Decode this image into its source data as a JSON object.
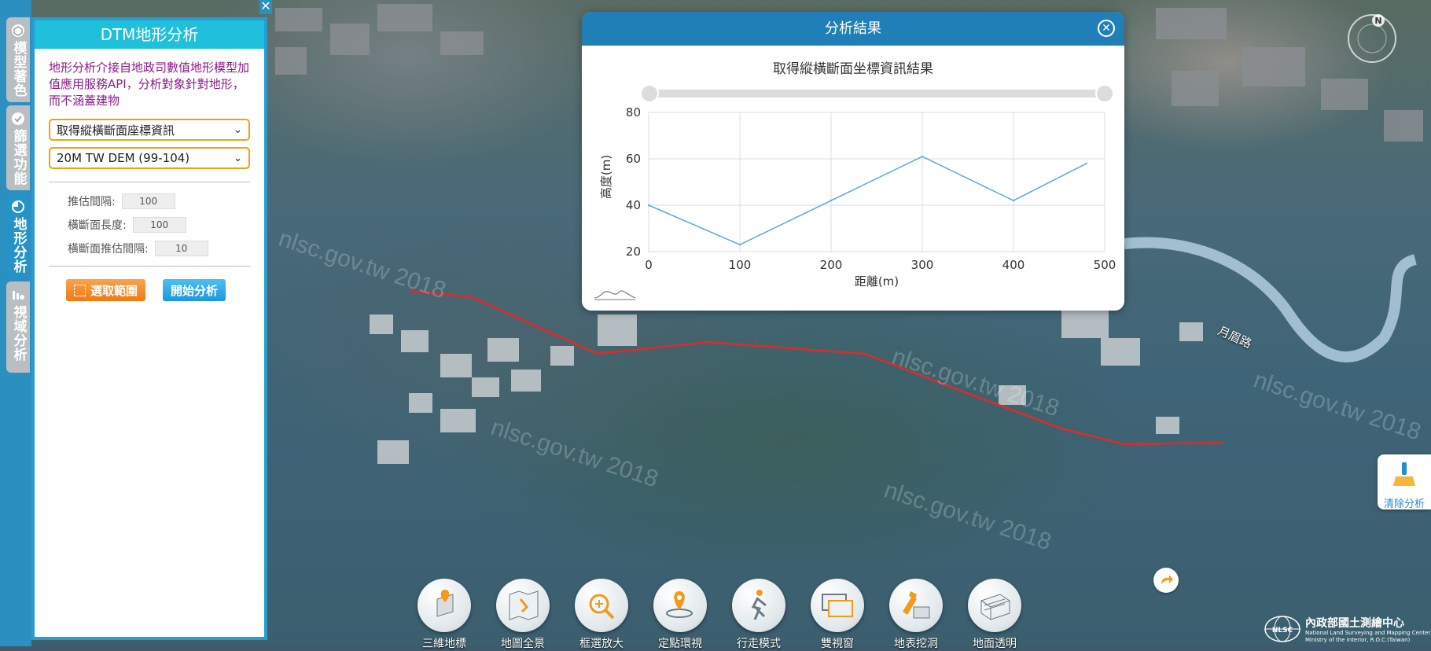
{
  "side_tabs": [
    {
      "label": "模型著色",
      "icon": "cube-icon",
      "active": false
    },
    {
      "label": "篩選功能",
      "icon": "check-circle-icon",
      "active": false
    },
    {
      "label": "地形分析",
      "icon": "pie-chart-icon",
      "active": true
    },
    {
      "label": "視域分析",
      "icon": "eye-chart-icon",
      "active": false
    }
  ],
  "panel": {
    "close_glyph": "✕",
    "title": "DTM地形分析",
    "description": "地形分析介接自地政司數值地形模型加值應用服務API，分析對象針對地形，而不涵蓋建物",
    "analysis_select": "取得縱橫斷面座標資訊",
    "dem_select": "20M TW DEM (99-104)",
    "params": [
      {
        "label": "推估間隔:",
        "value": "100"
      },
      {
        "label": "橫斷面長度:",
        "value": "100"
      },
      {
        "label": "橫斷面推估間隔:",
        "value": "10"
      }
    ],
    "select_range_label": "選取範圍",
    "start_analysis_label": "開始分析"
  },
  "result": {
    "header": "分析結果",
    "close_glyph": "✕"
  },
  "chart_data": {
    "type": "line",
    "title": "取得縱橫斷面坐標資訊結果",
    "xlabel": "距離(m)",
    "ylabel": "高度(m)",
    "xlim": [
      0,
      500
    ],
    "ylim": [
      20,
      80
    ],
    "xticks": [
      0,
      100,
      200,
      300,
      400,
      500
    ],
    "yticks": [
      20,
      40,
      60,
      80
    ],
    "grid": true,
    "color": "#5aa9dc",
    "series": [
      {
        "x": [
          0,
          100,
          200,
          300,
          400,
          480
        ],
        "y": [
          40,
          23,
          42,
          61,
          42,
          58
        ]
      }
    ]
  },
  "toolbar": [
    {
      "label": "三維地標",
      "icon": "3d-landmark-icon"
    },
    {
      "label": "地圖全景",
      "icon": "map-panorama-icon"
    },
    {
      "label": "框選放大",
      "icon": "zoom-box-icon"
    },
    {
      "label": "定點環視",
      "icon": "point-orbit-icon"
    },
    {
      "label": "行走模式",
      "icon": "walk-mode-icon"
    },
    {
      "label": "雙視窗",
      "icon": "dual-window-icon"
    },
    {
      "label": "地表挖洞",
      "icon": "dig-hole-icon"
    },
    {
      "label": "地面透明",
      "icon": "ground-transparent-icon"
    }
  ],
  "clear_analysis_label": "清除分析",
  "map": {
    "watermark": "nlsc.gov.tw 2018",
    "road_label": "月眉路",
    "compass_label": "N"
  },
  "logo": {
    "name": "內政部國土測繪中心",
    "en1": "National Land Surveying and Mapping Center",
    "en2": "Ministry of the Interior, R.O.C.(Taiwan)",
    "badge": "NLSC"
  }
}
